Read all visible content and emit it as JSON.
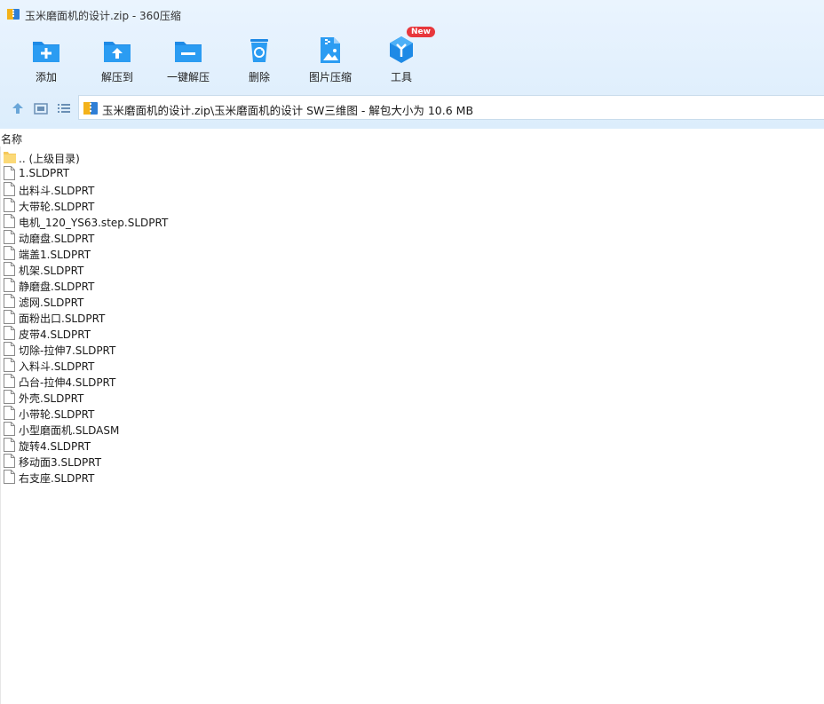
{
  "window": {
    "title": "玉米磨面机的设计.zip - 360压缩",
    "app_icon": "zip-archive-icon"
  },
  "toolbar": {
    "buttons": [
      {
        "label": "添加",
        "icon": "add-folder-icon"
      },
      {
        "label": "解压到",
        "icon": "extract-to-icon"
      },
      {
        "label": "一键解压",
        "icon": "one-click-extract-icon"
      },
      {
        "label": "删除",
        "icon": "recycle-bin-icon"
      },
      {
        "label": "图片压缩",
        "icon": "image-compress-icon"
      },
      {
        "label": "工具",
        "icon": "tools-icon",
        "badge": "New"
      }
    ]
  },
  "navigation": {
    "up_icon": "up-arrow-icon",
    "view_icon": "thumbnail-view-icon",
    "list_icon": "list-view-icon",
    "address": "玉米磨面机的设计.zip\\玉米磨面机的设计 SW三维图 - 解包大小为 10.6 MB"
  },
  "columns": {
    "name": "名称"
  },
  "files": [
    {
      "name": ".. (上级目录)",
      "type": "folder"
    },
    {
      "name": "1.SLDPRT",
      "type": "file"
    },
    {
      "name": "出料斗.SLDPRT",
      "type": "file"
    },
    {
      "name": "大带轮.SLDPRT",
      "type": "file"
    },
    {
      "name": "电机_120_YS63.step.SLDPRT",
      "type": "file"
    },
    {
      "name": "动磨盘.SLDPRT",
      "type": "file"
    },
    {
      "name": "端盖1.SLDPRT",
      "type": "file"
    },
    {
      "name": "机架.SLDPRT",
      "type": "file"
    },
    {
      "name": "静磨盘.SLDPRT",
      "type": "file"
    },
    {
      "name": "滤网.SLDPRT",
      "type": "file"
    },
    {
      "name": "面粉出口.SLDPRT",
      "type": "file"
    },
    {
      "name": "皮带4.SLDPRT",
      "type": "file"
    },
    {
      "name": "切除-拉伸7.SLDPRT",
      "type": "file"
    },
    {
      "name": "入料斗.SLDPRT",
      "type": "file"
    },
    {
      "name": "凸台-拉伸4.SLDPRT",
      "type": "file"
    },
    {
      "name": "外壳.SLDPRT",
      "type": "file"
    },
    {
      "name": "小带轮.SLDPRT",
      "type": "file"
    },
    {
      "name": "小型磨面机.SLDASM",
      "type": "file"
    },
    {
      "name": "旋转4.SLDPRT",
      "type": "file"
    },
    {
      "name": "移动面3.SLDPRT",
      "type": "file"
    },
    {
      "name": "右支座.SLDPRT",
      "type": "file"
    }
  ],
  "colors": {
    "accent": "#1e8ae6",
    "chrome_top": "#eaf4fe",
    "badge": "#e8373c"
  }
}
